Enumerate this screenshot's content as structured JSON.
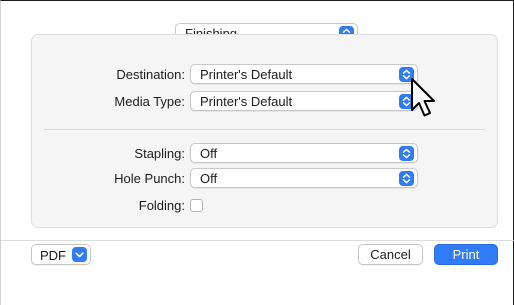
{
  "section_popup": {
    "value": "Finishing",
    "icon": "updown-chevron-icon"
  },
  "fields": {
    "destination": {
      "label": "Destination:",
      "value": "Printer's Default"
    },
    "media_type": {
      "label": "Media Type:",
      "value": "Printer's Default"
    },
    "stapling": {
      "label": "Stapling:",
      "value": "Off"
    },
    "hole_punch": {
      "label": "Hole Punch:",
      "value": "Off"
    },
    "folding": {
      "label": "Folding:",
      "checked": false
    }
  },
  "footer": {
    "pdf_label": "PDF",
    "cancel_label": "Cancel",
    "print_label": "Print"
  },
  "colors": {
    "accent": "#2f7cf6",
    "panel": "#f5f5f5"
  }
}
